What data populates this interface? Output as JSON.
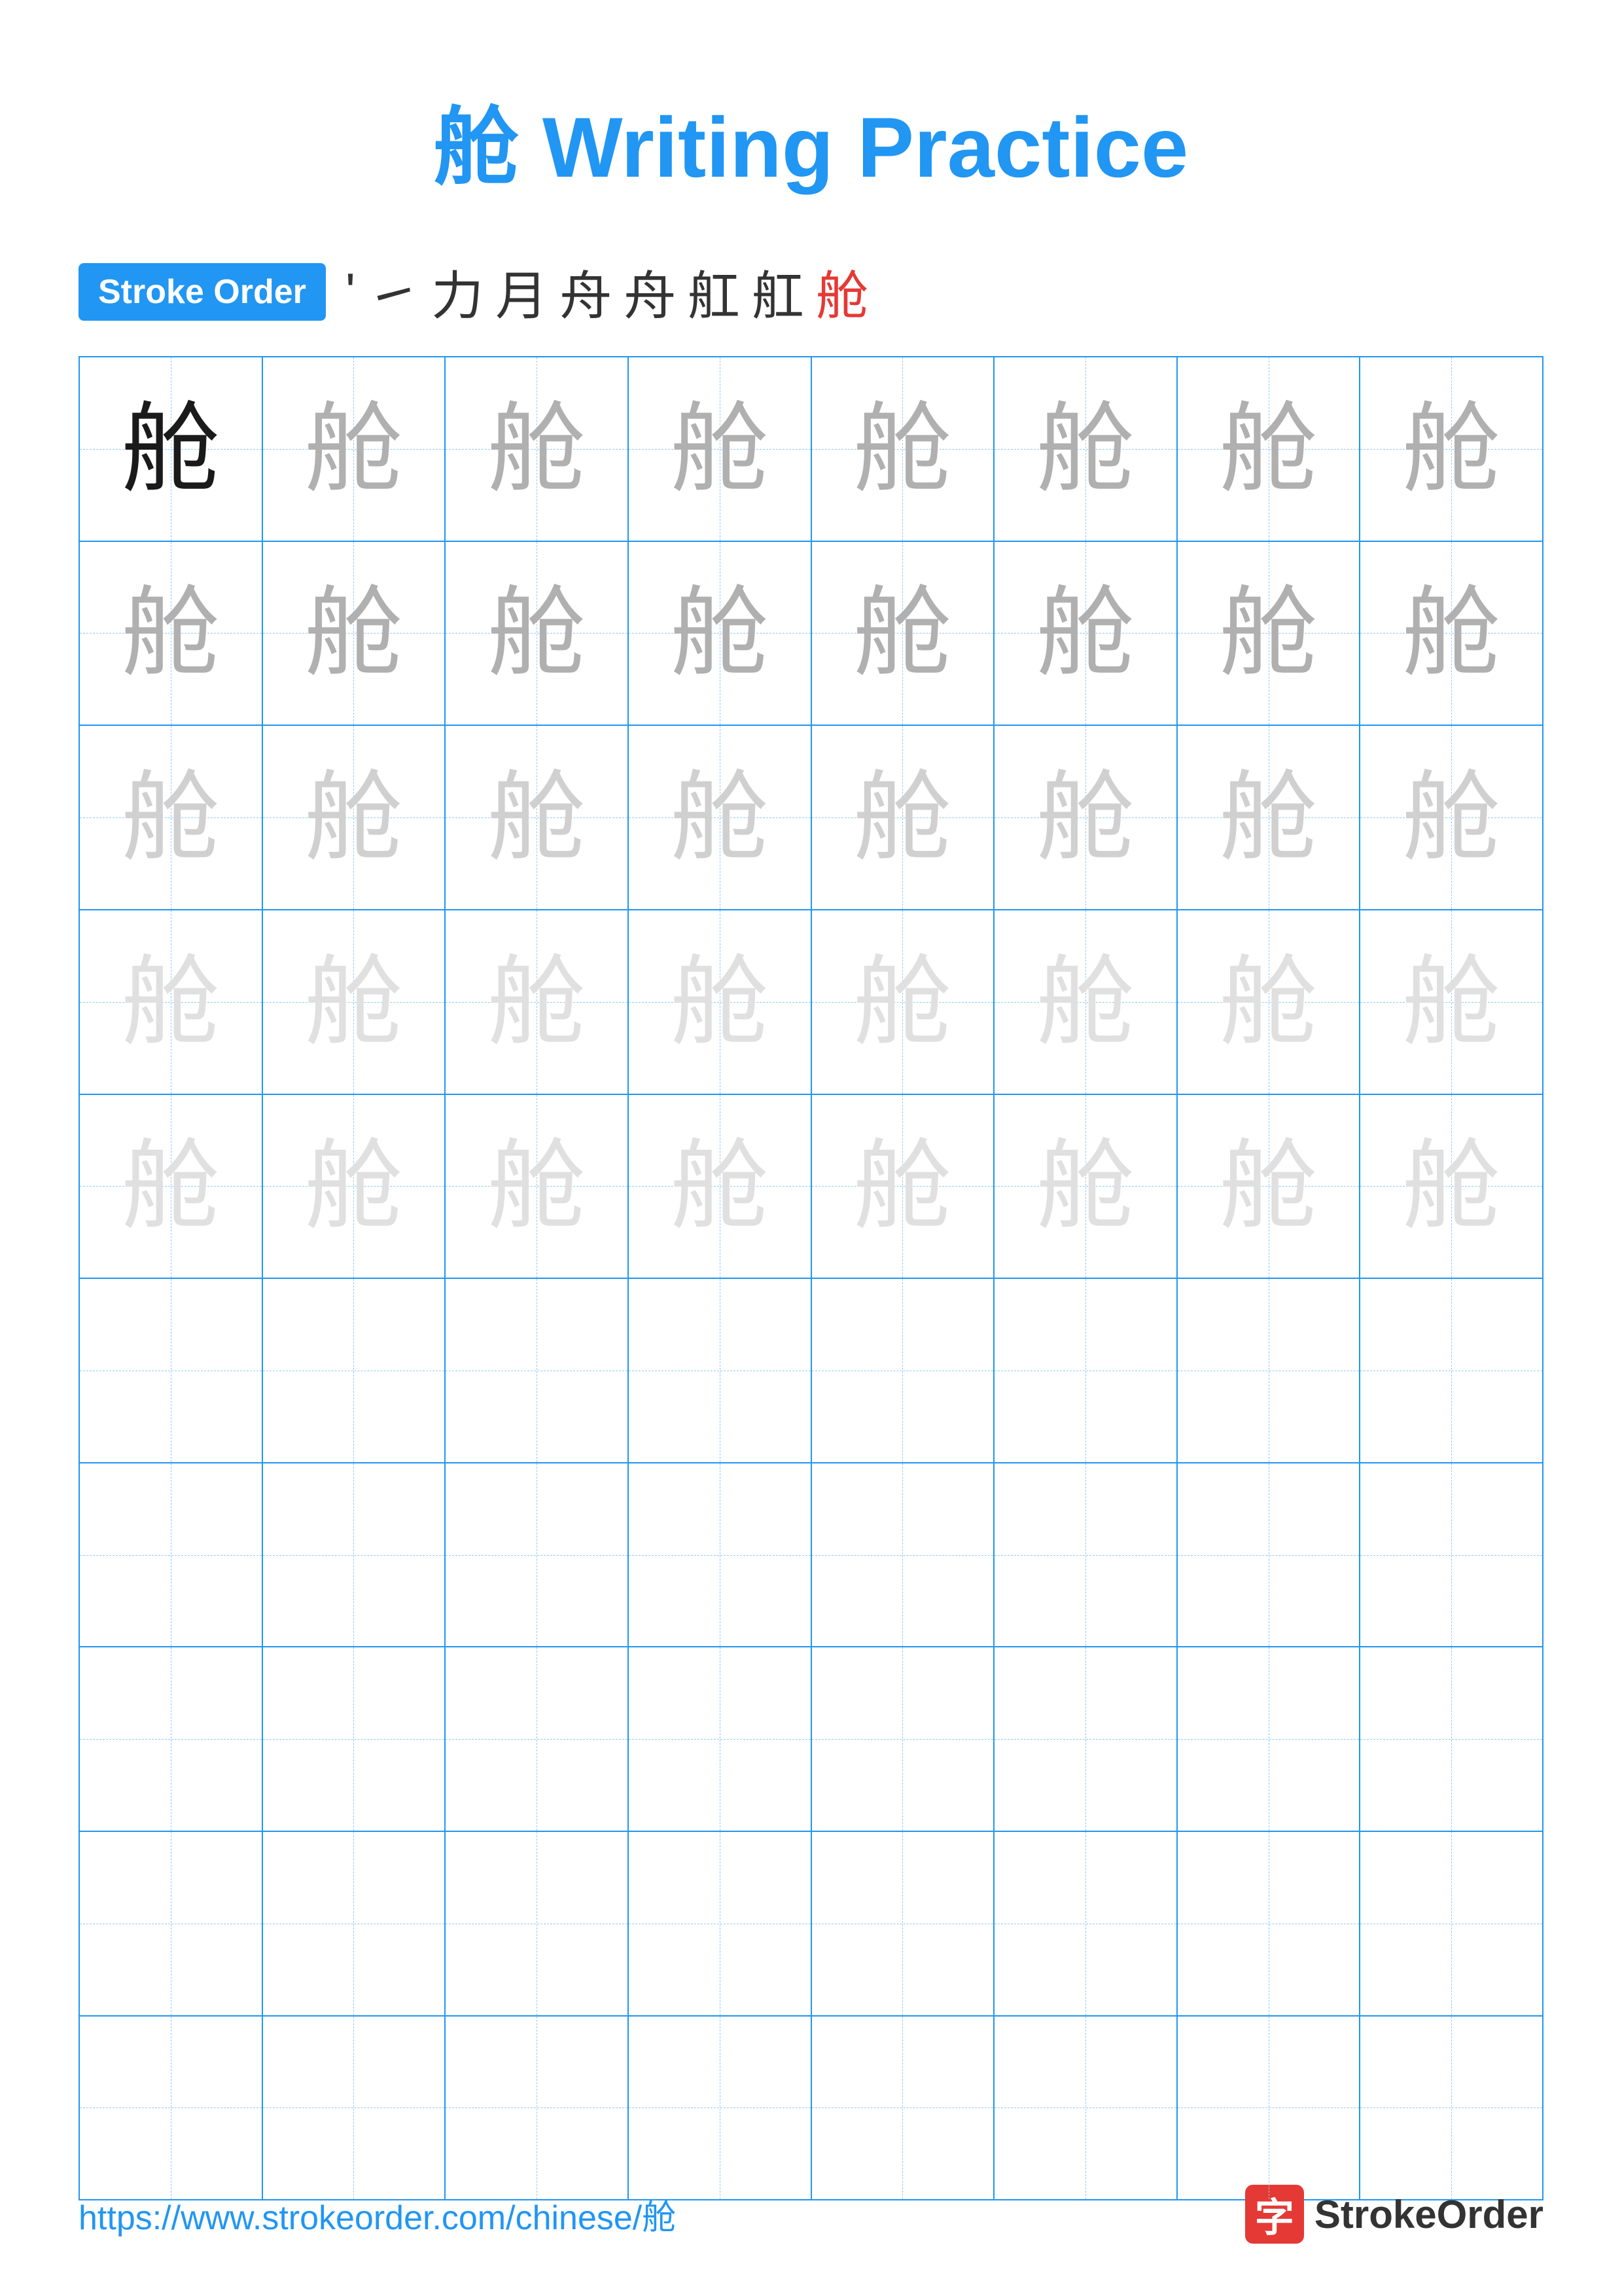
{
  "title": "舱 Writing Practice",
  "stroke_order_badge": "Stroke Order",
  "stroke_sequence": [
    "'",
    "㇀",
    "力",
    "月",
    "舟",
    "舟",
    "舡",
    "舡",
    "舱"
  ],
  "stroke_sequence_red_index": 8,
  "character": "舱",
  "grid": {
    "rows": 10,
    "cols": 8,
    "filled_rows": 5,
    "char_styles": [
      [
        "dark",
        "medium",
        "medium",
        "medium",
        "medium",
        "medium",
        "medium",
        "medium"
      ],
      [
        "medium",
        "medium",
        "medium",
        "medium",
        "medium",
        "medium",
        "medium",
        "medium"
      ],
      [
        "light",
        "light",
        "light",
        "light",
        "light",
        "light",
        "light",
        "light"
      ],
      [
        "lighter",
        "lighter",
        "lighter",
        "lighter",
        "lighter",
        "lighter",
        "lighter",
        "lighter"
      ],
      [
        "lighter",
        "lighter",
        "lighter",
        "lighter",
        "lighter",
        "lighter",
        "lighter",
        "lighter"
      ]
    ]
  },
  "footer": {
    "url": "https://www.strokeorder.com/chinese/舱",
    "logo_icon": "字",
    "logo_text": "StrokeOrder"
  }
}
